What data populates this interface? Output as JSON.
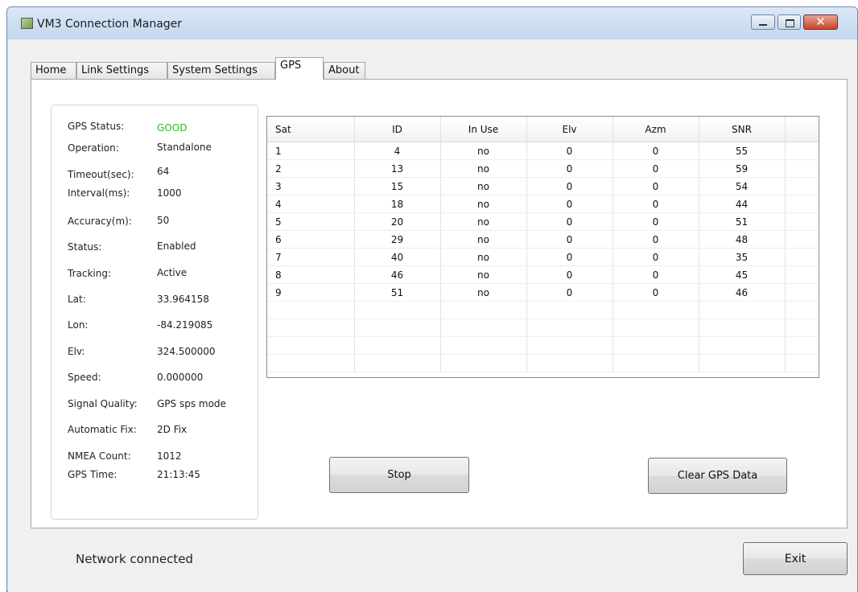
{
  "window": {
    "title": "VM3 Connection Manager",
    "controls": {
      "minimize": "minimize",
      "maximize": "maximize",
      "close": "✕"
    }
  },
  "tabs": [
    {
      "label": "Home"
    },
    {
      "label": "Link Settings"
    },
    {
      "label": "System Settings"
    },
    {
      "label": "GPS"
    },
    {
      "label": "About"
    }
  ],
  "active_tab": "GPS",
  "gps_info": {
    "status": {
      "label": "GPS Status:",
      "value": "GOOD",
      "color": "#22c21e"
    },
    "operation": {
      "label": "Operation:",
      "value": "Standalone"
    },
    "timeout": {
      "label": "Timeout(sec):",
      "value": "64"
    },
    "interval": {
      "label": "Interval(ms):",
      "value": "1000"
    },
    "accuracy": {
      "label": "Accuracy(m):",
      "value": "50"
    },
    "enable_status": {
      "label": "Status:",
      "value": "Enabled"
    },
    "tracking": {
      "label": "Tracking:",
      "value": "Active"
    },
    "lat": {
      "label": "Lat:",
      "value": "33.964158"
    },
    "lon": {
      "label": "Lon:",
      "value": "-84.219085"
    },
    "elv": {
      "label": "Elv:",
      "value": "324.500000"
    },
    "speed": {
      "label": "Speed:",
      "value": "0.000000"
    },
    "signal_quality": {
      "label": "Signal Quality:",
      "value": "GPS sps mode"
    },
    "automatic_fix": {
      "label": "Automatic Fix:",
      "value": "2D Fix"
    },
    "nmea_count": {
      "label": "NMEA Count:",
      "value": "1012"
    },
    "gps_time": {
      "label": "GPS Time:",
      "value": "21:13:45"
    }
  },
  "satellites": {
    "columns": [
      "Sat",
      "ID",
      "In Use",
      "Elv",
      "Azm",
      "SNR"
    ],
    "rows": [
      [
        "1",
        "4",
        "no",
        "0",
        "0",
        "55"
      ],
      [
        "2",
        "13",
        "no",
        "0",
        "0",
        "59"
      ],
      [
        "3",
        "15",
        "no",
        "0",
        "0",
        "54"
      ],
      [
        "4",
        "18",
        "no",
        "0",
        "0",
        "44"
      ],
      [
        "5",
        "20",
        "no",
        "0",
        "0",
        "51"
      ],
      [
        "6",
        "29",
        "no",
        "0",
        "0",
        "48"
      ],
      [
        "7",
        "40",
        "no",
        "0",
        "0",
        "35"
      ],
      [
        "8",
        "46",
        "no",
        "0",
        "0",
        "45"
      ],
      [
        "9",
        "51",
        "no",
        "0",
        "0",
        "46"
      ]
    ]
  },
  "buttons": {
    "stop": "Stop",
    "clear": "Clear GPS Data",
    "exit": "Exit"
  },
  "status_bar": {
    "text": "Network connected"
  }
}
